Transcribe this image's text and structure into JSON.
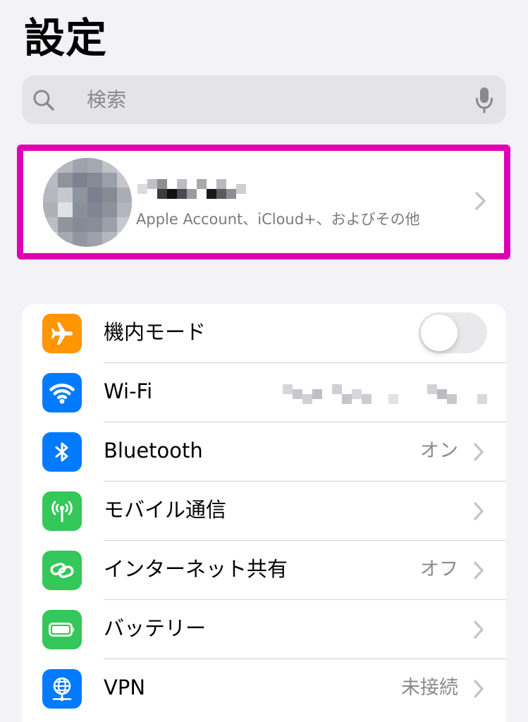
{
  "page": {
    "title": "設定"
  },
  "search": {
    "placeholder": "検索",
    "icon": "magnifyingglass",
    "mic_icon": "microphone"
  },
  "account": {
    "name": "",
    "subtitle": "Apple Account、iCloud+、およびその他",
    "highlight_color": "#e000b4"
  },
  "settings": {
    "rows": [
      {
        "id": "airplane",
        "label": "機内モード",
        "value": "",
        "icon": "airplane-icon",
        "icon_bg": "#ff9500",
        "control": "toggle",
        "toggle_on": false
      },
      {
        "id": "wifi",
        "label": "Wi-Fi",
        "value": "",
        "icon": "wifi-icon",
        "icon_bg": "#007aff",
        "control": "value"
      },
      {
        "id": "bluetooth",
        "label": "Bluetooth",
        "value": "オン",
        "icon": "bluetooth-icon",
        "icon_bg": "#007aff",
        "control": "chevron"
      },
      {
        "id": "mobile-data",
        "label": "モバイル通信",
        "value": "",
        "icon": "antenna-icon",
        "icon_bg": "#34c759",
        "control": "chevron"
      },
      {
        "id": "hotspot",
        "label": "インターネット共有",
        "value": "オフ",
        "icon": "link-icon",
        "icon_bg": "#34c759",
        "control": "chevron"
      },
      {
        "id": "battery",
        "label": "バッテリー",
        "value": "",
        "icon": "battery-icon",
        "icon_bg": "#34c759",
        "control": "chevron"
      },
      {
        "id": "vpn",
        "label": "VPN",
        "value": "未接続",
        "icon": "globe-icon",
        "icon_bg": "#007aff",
        "control": "chevron"
      }
    ]
  }
}
